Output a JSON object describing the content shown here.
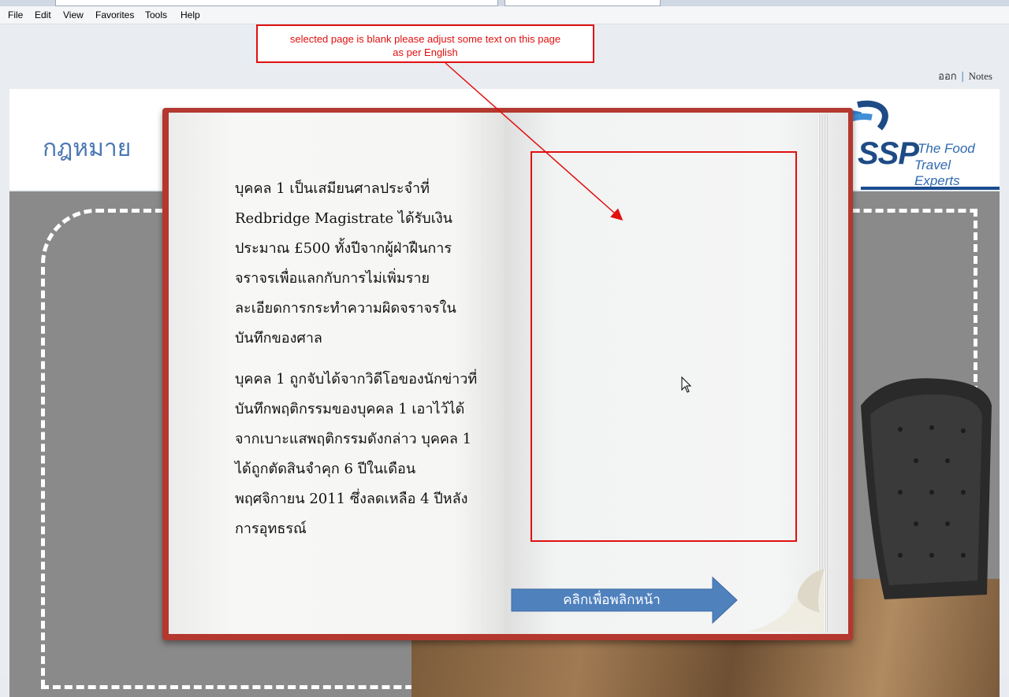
{
  "menu": {
    "items": [
      "File",
      "Edit",
      "View",
      "Favorites",
      "Tools",
      "Help"
    ]
  },
  "top_links": {
    "exit": "ออก",
    "notes": "Notes"
  },
  "header": {
    "title": "กฎหมาย",
    "logo_text": "SSP",
    "logo_tagline_1": "The Food",
    "logo_tagline_2": "Travel Experts"
  },
  "book": {
    "paragraph_1_lines": [
      "บุคคล 1 เป็นเสมียนศาลประจำที่",
      "Redbridge Magistrate ได้รับเงิน",
      "ประมาณ £500 ทั้งปีจากผู้ฝ่าฝืนการ",
      "จราจรเพื่อแลกกับการไม่เพิ่มราย",
      "ละเอียดการกระทำความผิดจราจรใน",
      "บันทึกของศาล"
    ],
    "paragraph_2_lines": [
      "บุคคล 1 ถูกจับได้จากวิดีโอของนักข่าวที่",
      "บันทึกพฤติกรรมของบุคคล 1 เอาไว้ได้",
      "จากเบาะแสพฤติกรรมดังกล่าว บุคคล 1",
      "ได้ถูกตัดสินจำคุก 6 ปีในเดือน",
      "พฤศจิกายน 2011 ซึ่งลดเหลือ 4 ปีหลัง",
      "การอุทธรณ์"
    ],
    "next_page_label": "คลิกเพื่อพลิกหน้า"
  },
  "annotation": {
    "line_1": "selected page is blank please adjust some text on this page",
    "line_2": "as per English",
    "color": "#e01010"
  },
  "colors": {
    "title_blue": "#4a77b4",
    "brand_navy": "#1e4b86",
    "button_blue": "#4f81bd",
    "book_red": "#b3382f"
  }
}
